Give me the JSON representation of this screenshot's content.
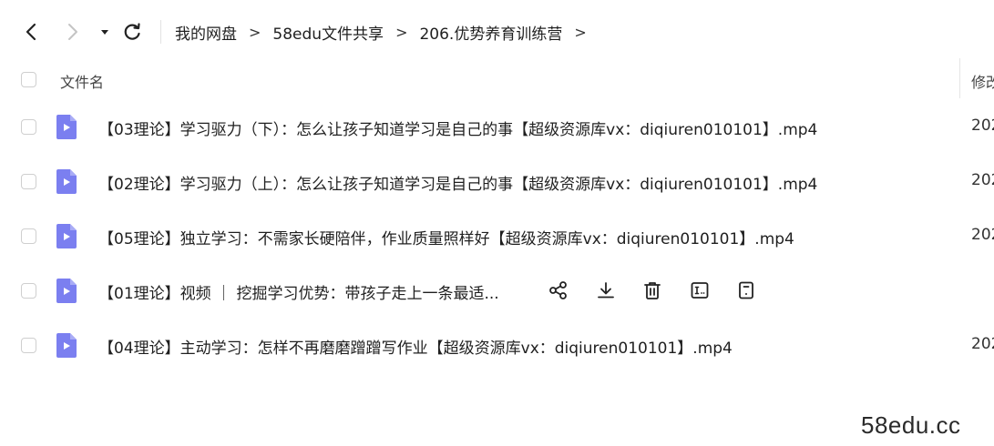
{
  "breadcrumb": [
    {
      "label": "我的网盘"
    },
    {
      "label": "58edu文件共享"
    },
    {
      "label": "206.优势养育训练营"
    }
  ],
  "breadcrumb_separator": ">",
  "header": {
    "name_label": "文件名",
    "modified_label": "修改"
  },
  "files": [
    {
      "name": "【03理论】学习驱力（下）：怎么让孩子知道学习是自己的事【超级资源库vx：diqiuren010101】.mp4",
      "date": "202"
    },
    {
      "name": "【02理论】学习驱力（上）：怎么让孩子知道学习是自己的事【超级资源库vx：diqiuren010101】.mp4",
      "date": "202"
    },
    {
      "name": "【05理论】独立学习：不需家长硬陪伴，作业质量照样好【超级资源库vx：diqiuren010101】.mp4",
      "date": "202"
    },
    {
      "name": "【01理论】视频 ｜ 挖掘学习优势：带孩子走上一条最适...",
      "date": ""
    },
    {
      "name": "【04理论】主动学习：怎样不再磨磨蹭蹭写作业【超级资源库vx：diqiuren010101】.mp4",
      "date": "202"
    }
  ],
  "hover_actions": [
    "share-icon",
    "download-icon",
    "delete-icon",
    "rename-icon",
    "details-icon"
  ],
  "watermark": "58edu.cc",
  "colors": {
    "file_icon": "#7b7ff0",
    "text": "#1f1f1f",
    "border": "#cfcfcf"
  }
}
